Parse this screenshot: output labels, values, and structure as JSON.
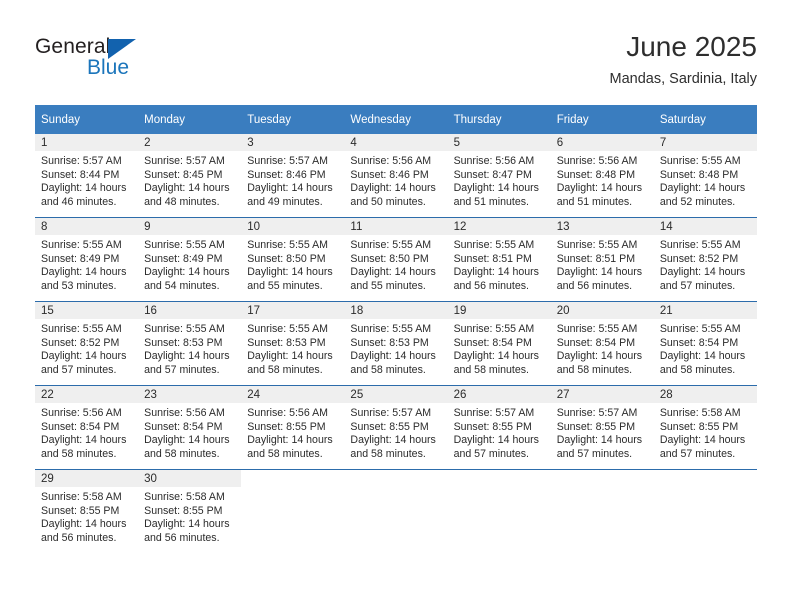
{
  "brand": {
    "name_top": "General",
    "name_bottom": "Blue",
    "triangle_color": "#1262ae",
    "blue_color": "#1b75bb"
  },
  "header": {
    "month_title": "June 2025",
    "location": "Mandas, Sardinia, Italy"
  },
  "calendar": {
    "header_bg": "#3a7dbf",
    "row_divider": "#2c6cab",
    "daynum_bg": "#efefef",
    "weekday_headers": [
      "Sunday",
      "Monday",
      "Tuesday",
      "Wednesday",
      "Thursday",
      "Friday",
      "Saturday"
    ],
    "weeks": [
      [
        {
          "day": "1",
          "sunrise": "Sunrise: 5:57 AM",
          "sunset": "Sunset: 8:44 PM",
          "daylight1": "Daylight: 14 hours",
          "daylight2": "and 46 minutes."
        },
        {
          "day": "2",
          "sunrise": "Sunrise: 5:57 AM",
          "sunset": "Sunset: 8:45 PM",
          "daylight1": "Daylight: 14 hours",
          "daylight2": "and 48 minutes."
        },
        {
          "day": "3",
          "sunrise": "Sunrise: 5:57 AM",
          "sunset": "Sunset: 8:46 PM",
          "daylight1": "Daylight: 14 hours",
          "daylight2": "and 49 minutes."
        },
        {
          "day": "4",
          "sunrise": "Sunrise: 5:56 AM",
          "sunset": "Sunset: 8:46 PM",
          "daylight1": "Daylight: 14 hours",
          "daylight2": "and 50 minutes."
        },
        {
          "day": "5",
          "sunrise": "Sunrise: 5:56 AM",
          "sunset": "Sunset: 8:47 PM",
          "daylight1": "Daylight: 14 hours",
          "daylight2": "and 51 minutes."
        },
        {
          "day": "6",
          "sunrise": "Sunrise: 5:56 AM",
          "sunset": "Sunset: 8:48 PM",
          "daylight1": "Daylight: 14 hours",
          "daylight2": "and 51 minutes."
        },
        {
          "day": "7",
          "sunrise": "Sunrise: 5:55 AM",
          "sunset": "Sunset: 8:48 PM",
          "daylight1": "Daylight: 14 hours",
          "daylight2": "and 52 minutes."
        }
      ],
      [
        {
          "day": "8",
          "sunrise": "Sunrise: 5:55 AM",
          "sunset": "Sunset: 8:49 PM",
          "daylight1": "Daylight: 14 hours",
          "daylight2": "and 53 minutes."
        },
        {
          "day": "9",
          "sunrise": "Sunrise: 5:55 AM",
          "sunset": "Sunset: 8:49 PM",
          "daylight1": "Daylight: 14 hours",
          "daylight2": "and 54 minutes."
        },
        {
          "day": "10",
          "sunrise": "Sunrise: 5:55 AM",
          "sunset": "Sunset: 8:50 PM",
          "daylight1": "Daylight: 14 hours",
          "daylight2": "and 55 minutes."
        },
        {
          "day": "11",
          "sunrise": "Sunrise: 5:55 AM",
          "sunset": "Sunset: 8:50 PM",
          "daylight1": "Daylight: 14 hours",
          "daylight2": "and 55 minutes."
        },
        {
          "day": "12",
          "sunrise": "Sunrise: 5:55 AM",
          "sunset": "Sunset: 8:51 PM",
          "daylight1": "Daylight: 14 hours",
          "daylight2": "and 56 minutes."
        },
        {
          "day": "13",
          "sunrise": "Sunrise: 5:55 AM",
          "sunset": "Sunset: 8:51 PM",
          "daylight1": "Daylight: 14 hours",
          "daylight2": "and 56 minutes."
        },
        {
          "day": "14",
          "sunrise": "Sunrise: 5:55 AM",
          "sunset": "Sunset: 8:52 PM",
          "daylight1": "Daylight: 14 hours",
          "daylight2": "and 57 minutes."
        }
      ],
      [
        {
          "day": "15",
          "sunrise": "Sunrise: 5:55 AM",
          "sunset": "Sunset: 8:52 PM",
          "daylight1": "Daylight: 14 hours",
          "daylight2": "and 57 minutes."
        },
        {
          "day": "16",
          "sunrise": "Sunrise: 5:55 AM",
          "sunset": "Sunset: 8:53 PM",
          "daylight1": "Daylight: 14 hours",
          "daylight2": "and 57 minutes."
        },
        {
          "day": "17",
          "sunrise": "Sunrise: 5:55 AM",
          "sunset": "Sunset: 8:53 PM",
          "daylight1": "Daylight: 14 hours",
          "daylight2": "and 58 minutes."
        },
        {
          "day": "18",
          "sunrise": "Sunrise: 5:55 AM",
          "sunset": "Sunset: 8:53 PM",
          "daylight1": "Daylight: 14 hours",
          "daylight2": "and 58 minutes."
        },
        {
          "day": "19",
          "sunrise": "Sunrise: 5:55 AM",
          "sunset": "Sunset: 8:54 PM",
          "daylight1": "Daylight: 14 hours",
          "daylight2": "and 58 minutes."
        },
        {
          "day": "20",
          "sunrise": "Sunrise: 5:55 AM",
          "sunset": "Sunset: 8:54 PM",
          "daylight1": "Daylight: 14 hours",
          "daylight2": "and 58 minutes."
        },
        {
          "day": "21",
          "sunrise": "Sunrise: 5:55 AM",
          "sunset": "Sunset: 8:54 PM",
          "daylight1": "Daylight: 14 hours",
          "daylight2": "and 58 minutes."
        }
      ],
      [
        {
          "day": "22",
          "sunrise": "Sunrise: 5:56 AM",
          "sunset": "Sunset: 8:54 PM",
          "daylight1": "Daylight: 14 hours",
          "daylight2": "and 58 minutes."
        },
        {
          "day": "23",
          "sunrise": "Sunrise: 5:56 AM",
          "sunset": "Sunset: 8:54 PM",
          "daylight1": "Daylight: 14 hours",
          "daylight2": "and 58 minutes."
        },
        {
          "day": "24",
          "sunrise": "Sunrise: 5:56 AM",
          "sunset": "Sunset: 8:55 PM",
          "daylight1": "Daylight: 14 hours",
          "daylight2": "and 58 minutes."
        },
        {
          "day": "25",
          "sunrise": "Sunrise: 5:57 AM",
          "sunset": "Sunset: 8:55 PM",
          "daylight1": "Daylight: 14 hours",
          "daylight2": "and 58 minutes."
        },
        {
          "day": "26",
          "sunrise": "Sunrise: 5:57 AM",
          "sunset": "Sunset: 8:55 PM",
          "daylight1": "Daylight: 14 hours",
          "daylight2": "and 57 minutes."
        },
        {
          "day": "27",
          "sunrise": "Sunrise: 5:57 AM",
          "sunset": "Sunset: 8:55 PM",
          "daylight1": "Daylight: 14 hours",
          "daylight2": "and 57 minutes."
        },
        {
          "day": "28",
          "sunrise": "Sunrise: 5:58 AM",
          "sunset": "Sunset: 8:55 PM",
          "daylight1": "Daylight: 14 hours",
          "daylight2": "and 57 minutes."
        }
      ],
      [
        {
          "day": "29",
          "sunrise": "Sunrise: 5:58 AM",
          "sunset": "Sunset: 8:55 PM",
          "daylight1": "Daylight: 14 hours",
          "daylight2": "and 56 minutes."
        },
        {
          "day": "30",
          "sunrise": "Sunrise: 5:58 AM",
          "sunset": "Sunset: 8:55 PM",
          "daylight1": "Daylight: 14 hours",
          "daylight2": "and 56 minutes."
        },
        {
          "day": "",
          "sunrise": "",
          "sunset": "",
          "daylight1": "",
          "daylight2": ""
        },
        {
          "day": "",
          "sunrise": "",
          "sunset": "",
          "daylight1": "",
          "daylight2": ""
        },
        {
          "day": "",
          "sunrise": "",
          "sunset": "",
          "daylight1": "",
          "daylight2": ""
        },
        {
          "day": "",
          "sunrise": "",
          "sunset": "",
          "daylight1": "",
          "daylight2": ""
        },
        {
          "day": "",
          "sunrise": "",
          "sunset": "",
          "daylight1": "",
          "daylight2": ""
        }
      ]
    ]
  }
}
